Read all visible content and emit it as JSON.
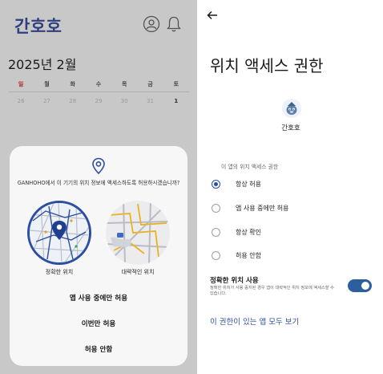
{
  "left": {
    "logo": "간호호",
    "header_icons": [
      "account-circle-icon",
      "bell-icon"
    ],
    "month_title": "2025년 2월",
    "weekdays": [
      "일",
      "월",
      "화",
      "수",
      "목",
      "금",
      "토"
    ],
    "days": [
      "26",
      "27",
      "28",
      "29",
      "30",
      "31",
      "1"
    ],
    "dialog": {
      "message": "GANHOHO에서 이 기기의 위치 정보에 액세스하도록 허용하시겠습니까?",
      "precise_label": "정확한 위치",
      "approx_label": "대략적인 위치",
      "buttons": {
        "while_using": "앱 사용 중에만 허용",
        "only_this_time": "이번만 허용",
        "deny": "허용 안함"
      }
    }
  },
  "right": {
    "title": "위치 액세스 권한",
    "app_name": "간호호",
    "section_label": "이 앱의 위치 액세스 권한",
    "options": [
      {
        "label": "항상 허용",
        "selected": true
      },
      {
        "label": "앱 사용 중에만 허용",
        "selected": false
      },
      {
        "label": "항상 확인",
        "selected": false
      },
      {
        "label": "허용 안함",
        "selected": false
      }
    ],
    "precise": {
      "title": "정확한 위치 사용",
      "description": "정확한 위치가 사용 중지된 경우 앱이 대략적인 위치 정보에 액세스할 수 있습니다.",
      "enabled": true
    },
    "all_apps_link": "이 권한이 있는 앱 모두 보기"
  },
  "colors": {
    "accent": "#2d4fa1",
    "logo": "#3b4f9a",
    "sunday": "#d9362c",
    "toggle": "#2d5f9e"
  }
}
